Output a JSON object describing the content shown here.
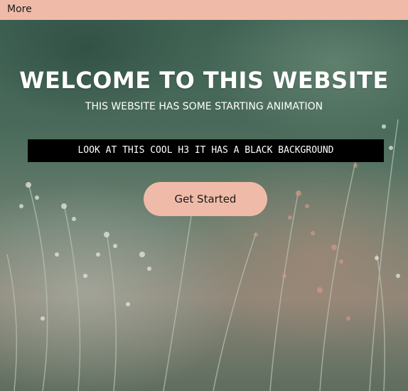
{
  "topbar": {
    "more_label": "More"
  },
  "hero": {
    "title": "WELCOME TO THIS WEBSITE",
    "subtitle": "THIS WEBSITE HAS SOME STARTING ANIMATION",
    "h3_text": "LOOK AT THIS COOL H3 IT HAS A BLACK BACKGROUND",
    "cta_label": "Get Started"
  },
  "colors": {
    "topbar_bg": "#efbba8",
    "button_bg": "#efbba8",
    "h3_bg": "#000000",
    "hero_text": "#ffffff"
  }
}
